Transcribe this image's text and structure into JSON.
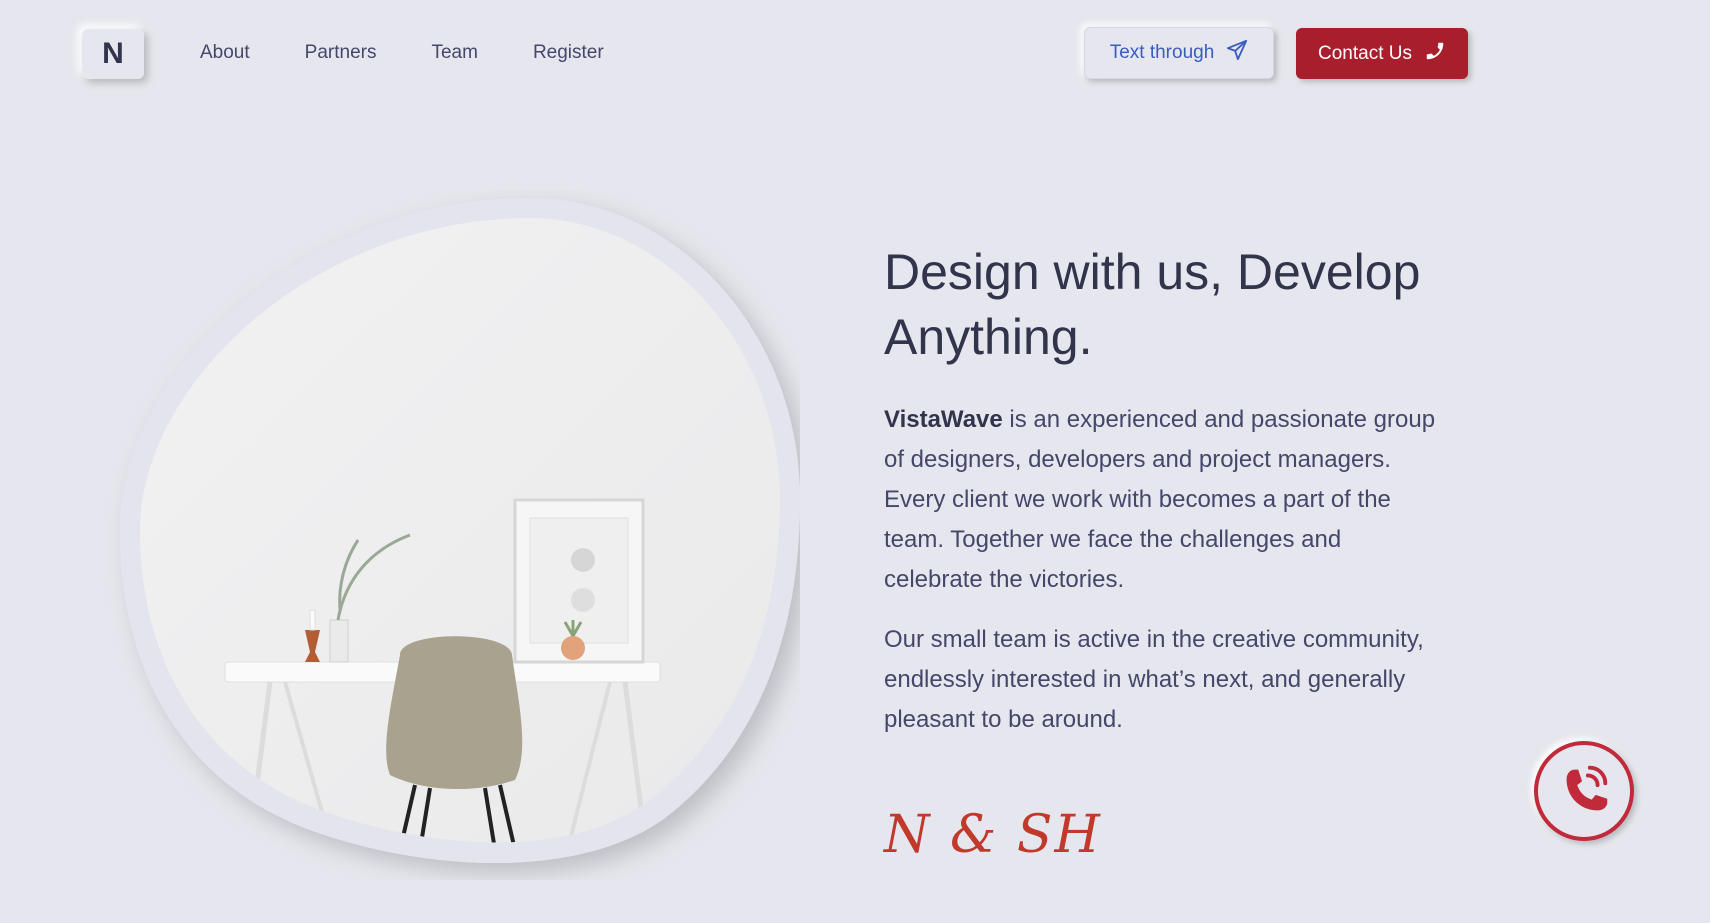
{
  "brand": {
    "logo_letter": "N"
  },
  "nav": {
    "links": [
      "About",
      "Partners",
      "Team",
      "Register"
    ],
    "text_through_label": "Text through",
    "contact_label": "Contact Us"
  },
  "hero": {
    "headline": "Design with us, Develop Anything.",
    "brand_name": "VistaWave",
    "para1_rest": " is an experienced and passionate group of designers, developers and project managers. Every client we work with becomes a part of the team. Together we face the challenges and celebrate the victories.",
    "para2": "Our small team is active in the creative community, endlessly interested in what’s next, and generally pleasant to be around.",
    "signature": "N & SH",
    "image_alt": "White desk with chair, plant and framed art"
  },
  "colors": {
    "background": "#e6e7ee",
    "text_dark": "#31344b",
    "accent_red": "#a91e2c",
    "accent_blue": "#3a5bbf"
  },
  "icons": {
    "send": "paper-plane-icon",
    "phone": "phone-icon",
    "float_phone": "phone-volume-icon"
  }
}
